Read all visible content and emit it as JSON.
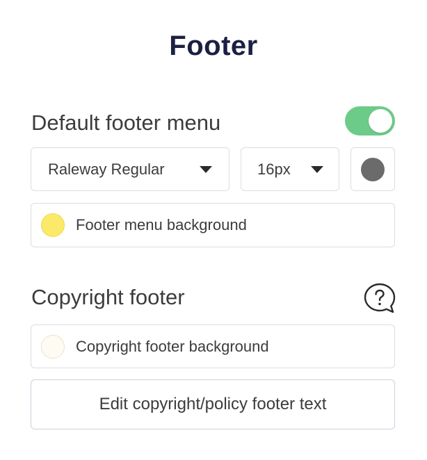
{
  "panel": {
    "title": "Footer"
  },
  "default_footer_menu": {
    "label": "Default footer menu",
    "enabled": true,
    "font": "Raleway Regular",
    "font_size": "16px",
    "text_color": "#6b6b6b",
    "background_label": "Footer menu background",
    "background_color": "#fbe96a"
  },
  "copyright_footer": {
    "label": "Copyright footer",
    "help_icon": "question-bubble-icon",
    "background_label": "Copyright footer background",
    "background_color": "#fdfbf2",
    "edit_button_label": "Edit copyright/policy footer text"
  }
}
